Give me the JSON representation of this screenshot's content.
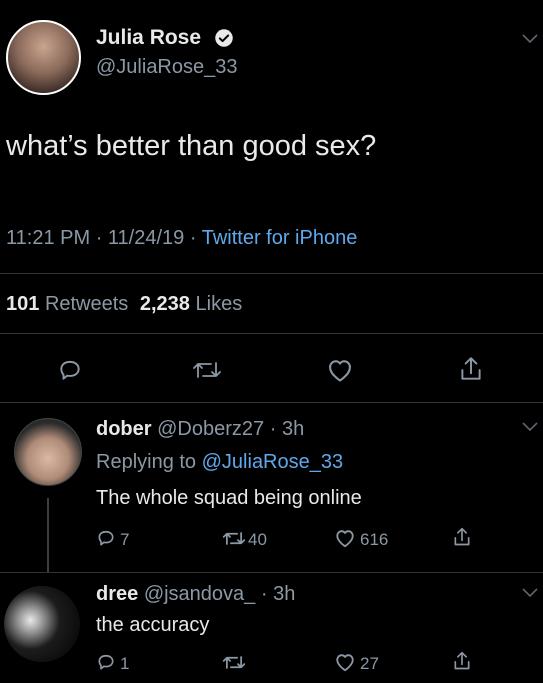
{
  "tweet": {
    "author_name": "Julia Rose",
    "author_handle": "@JuliaRose_33",
    "text": "what’s better than good sex?",
    "time": "11:21 PM",
    "date": "11/24/19",
    "source": "Twitter for iPhone",
    "retweets_count": "101",
    "retweets_label": "Retweets",
    "likes_count": "2,238",
    "likes_label": "Likes"
  },
  "replies": [
    {
      "name": "dober",
      "handle": "@Doberz27",
      "age": "3h",
      "replying_prefix": "Replying to",
      "replying_handle": "@JuliaRose_33",
      "text": "The whole squad being online",
      "reply_count": "7",
      "retweet_count": "40",
      "like_count": "616"
    },
    {
      "name": "dree",
      "handle": "@jsandova_",
      "age": "3h",
      "text": "the accuracy",
      "reply_count": "1",
      "retweet_count": "",
      "like_count": "27"
    }
  ],
  "icons": {
    "verified": "verified-badge-icon",
    "chevron": "chevron-down-icon",
    "reply": "reply-icon",
    "retweet": "retweet-icon",
    "like": "heart-icon",
    "share": "share-icon"
  },
  "colors": {
    "background": "#000000",
    "text": "#e7e9ea",
    "muted": "#8b98a5",
    "link": "#5fa8ec",
    "divider": "#2f3336"
  }
}
